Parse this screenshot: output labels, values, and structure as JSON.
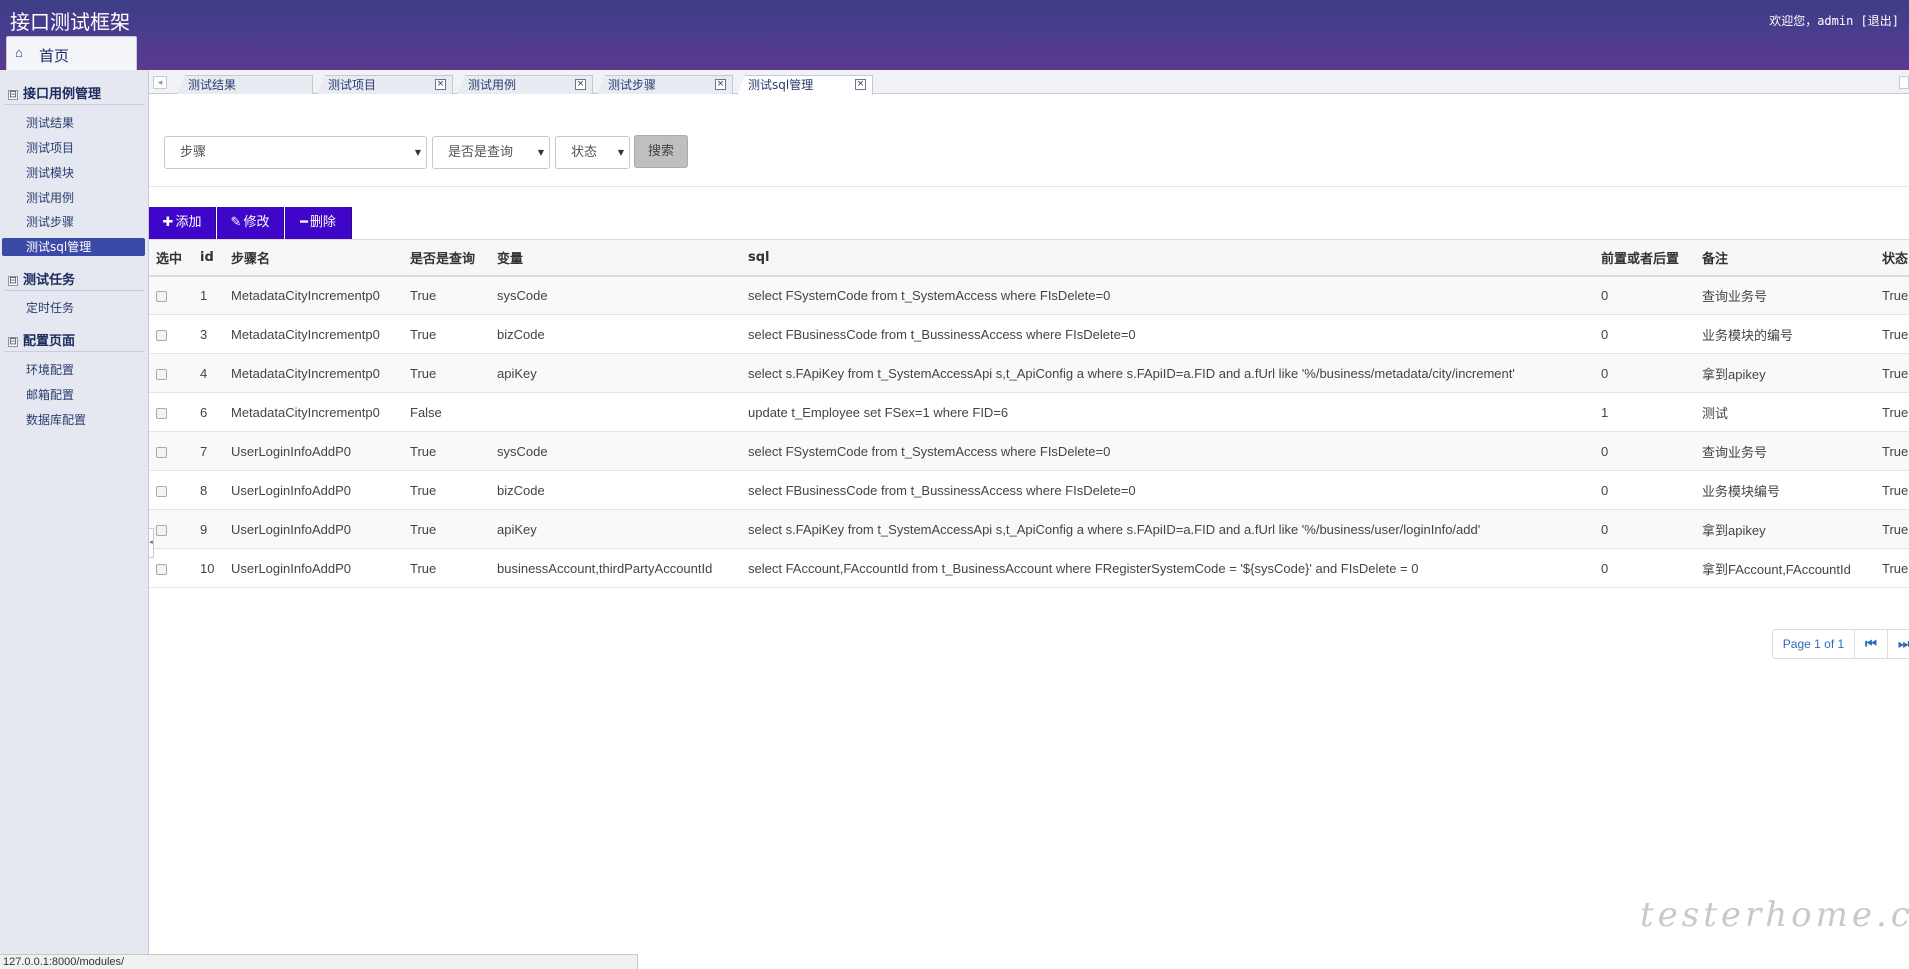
{
  "header": {
    "title": "接口测试框架",
    "welcome": "欢迎您，admin",
    "logout": "[退出]",
    "home_icon": "home-icon",
    "home_label": "首页"
  },
  "sidebar": {
    "groups": [
      {
        "title": "接口用例管理",
        "items": [
          "测试结果",
          "测试项目",
          "测试模块",
          "测试用例",
          "测试步骤",
          "测试sql管理"
        ]
      },
      {
        "title": "测试任务",
        "items": [
          "定时任务"
        ]
      },
      {
        "title": "配置页面",
        "items": [
          "环境配置",
          "邮箱配置",
          "数据库配置"
        ]
      }
    ],
    "active_item": "测试sql管理",
    "toggle_symbol": "⊟"
  },
  "tabs": [
    {
      "label": "测试结果",
      "closable": false
    },
    {
      "label": "测试项目",
      "closable": true
    },
    {
      "label": "测试用例",
      "closable": true
    },
    {
      "label": "测试步骤",
      "closable": true
    },
    {
      "label": "测试sql管理",
      "closable": true,
      "active": true
    }
  ],
  "search": {
    "step_select": "步骤",
    "is_query_select": "是否是查询",
    "status_select": "状态",
    "search_button": "搜索"
  },
  "toolbar": {
    "add_label": "添加",
    "edit_label": "修改",
    "delete_label": "删除"
  },
  "table": {
    "columns": [
      "选中",
      "id",
      "步骤名",
      "是否是查询",
      "变量",
      "sql",
      "前置或者后置",
      "备注",
      "状态"
    ],
    "rows": [
      {
        "id": "1",
        "step": "MetadataCityIncrementp0",
        "is_query": "True",
        "var": "sysCode",
        "sql": "select FSystemCode from t_SystemAccess where FIsDelete=0",
        "pre_post": "0",
        "remark": "查询业务号",
        "status": "True"
      },
      {
        "id": "3",
        "step": "MetadataCityIncrementp0",
        "is_query": "True",
        "var": "bizCode",
        "sql": "select FBusinessCode from t_BussinessAccess where FIsDelete=0",
        "pre_post": "0",
        "remark": "业务模块的编号",
        "status": "True"
      },
      {
        "id": "4",
        "step": "MetadataCityIncrementp0",
        "is_query": "True",
        "var": "apiKey",
        "sql": "select s.FApiKey from t_SystemAccessApi s,t_ApiConfig a where s.FApiID=a.FID and a.fUrl like '%/business/metadata/city/increment'",
        "pre_post": "0",
        "remark": "拿到apikey",
        "status": "True"
      },
      {
        "id": "6",
        "step": "MetadataCityIncrementp0",
        "is_query": "False",
        "var": "",
        "sql": "update t_Employee set FSex=1 where FID=6",
        "pre_post": "1",
        "remark": "测试",
        "status": "True"
      },
      {
        "id": "7",
        "step": "UserLoginInfoAddP0",
        "is_query": "True",
        "var": "sysCode",
        "sql": "select FSystemCode from t_SystemAccess where FIsDelete=0",
        "pre_post": "0",
        "remark": "查询业务号",
        "status": "True"
      },
      {
        "id": "8",
        "step": "UserLoginInfoAddP0",
        "is_query": "True",
        "var": "bizCode",
        "sql": "select FBusinessCode from t_BussinessAccess where FIsDelete=0",
        "pre_post": "0",
        "remark": "业务模块编号",
        "status": "True"
      },
      {
        "id": "9",
        "step": "UserLoginInfoAddP0",
        "is_query": "True",
        "var": "apiKey",
        "sql": "select s.FApiKey from t_SystemAccessApi s,t_ApiConfig a where s.FApiID=a.FID and a.fUrl like '%/business/user/loginInfo/add'",
        "pre_post": "0",
        "remark": "拿到apikey",
        "status": "True"
      },
      {
        "id": "10",
        "step": "UserLoginInfoAddP0",
        "is_query": "True",
        "var": "businessAccount,thirdPartyAccountId",
        "sql": "select FAccount,FAccountId from t_BusinessAccount where FRegisterSystemCode = '${sysCode}' and FIsDelete = 0",
        "pre_post": "0",
        "remark": "拿到FAccount,FAccountId",
        "status": "True"
      }
    ]
  },
  "pager": {
    "info": "Page 1 of 1",
    "first_icon": "first-page-icon",
    "next_icon": "next-page-icon"
  },
  "status_url": "127.0.0.1:8000/modules/",
  "watermark": "testerhome.com",
  "colors": {
    "header": "#4a3c8e",
    "sidebar_active": "#3a4aa6",
    "toolbar_button": "#3f06c9"
  }
}
